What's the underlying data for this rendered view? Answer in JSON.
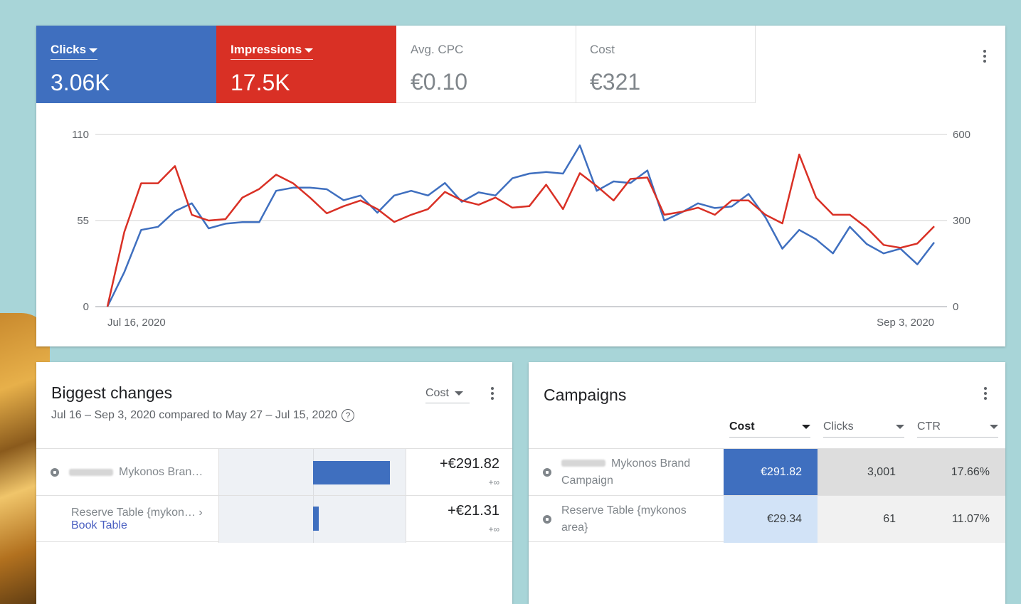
{
  "overview": {
    "metrics": [
      {
        "label": "Clicks",
        "value": "3.06K"
      },
      {
        "label": "Impressions",
        "value": "17.5K"
      },
      {
        "label": "Avg. CPC",
        "value": "€0.10"
      },
      {
        "label": "Cost",
        "value": "€321"
      }
    ],
    "colors": {
      "clicks": "#3f6fbf",
      "impressions": "#d93025"
    }
  },
  "chart_data": {
    "type": "line",
    "x_start_label": "Jul 16, 2020",
    "x_end_label": "Sep 3, 2020",
    "left_axis": {
      "ticks": [
        "110",
        "55",
        "0"
      ],
      "ylim": [
        0,
        110
      ]
    },
    "right_axis": {
      "ticks": [
        "600",
        "300",
        "0"
      ],
      "ylim": [
        0,
        600
      ]
    },
    "grid": true,
    "series": [
      {
        "name": "Clicks",
        "axis": "left",
        "color": "#3f6fbf",
        "values": [
          0,
          22,
          49,
          51,
          61,
          66,
          50,
          53,
          54,
          54,
          74,
          76,
          76,
          75,
          68,
          71,
          60,
          71,
          74,
          71,
          79,
          67,
          73,
          71,
          82,
          85,
          86,
          85,
          103,
          74,
          80,
          79,
          87,
          55,
          60,
          66,
          63,
          64,
          72,
          57,
          37,
          49,
          43,
          34,
          51,
          40,
          34,
          37,
          27,
          41
        ]
      },
      {
        "name": "Impressions",
        "axis": "right",
        "color": "#d93025",
        "values": [
          0,
          260,
          430,
          430,
          490,
          320,
          300,
          305,
          380,
          410,
          460,
          430,
          380,
          325,
          350,
          370,
          340,
          295,
          320,
          340,
          400,
          370,
          355,
          380,
          345,
          350,
          425,
          340,
          465,
          420,
          370,
          445,
          450,
          320,
          330,
          345,
          320,
          370,
          370,
          320,
          290,
          530,
          380,
          320,
          320,
          275,
          215,
          205,
          220,
          280
        ]
      }
    ]
  },
  "changes": {
    "title": "Biggest changes",
    "subtitle": "Jul 16 – Sep 3, 2020 compared to May 27 – Jul 15, 2020",
    "sort_label": "Cost",
    "rows": [
      {
        "name": "Mykonos Bran…",
        "value": "+€291.82",
        "sub": "+∞",
        "bar_fraction": 1.0
      },
      {
        "name": "Reserve Table {mykon… ›",
        "link": "Book Table",
        "value": "+€21.31",
        "sub": "+∞",
        "bar_fraction": 0.073
      }
    ]
  },
  "campaigns": {
    "title": "Campaigns",
    "columns": [
      "Cost",
      "Clicks",
      "CTR"
    ],
    "rows": [
      {
        "name_line1": "Mykonos Brand",
        "name_line2": "Campaign",
        "cost": "€291.82",
        "clicks": "3,001",
        "ctr": "17.66%"
      },
      {
        "name_line1": "Reserve Table {mykonos",
        "name_line2": "area}",
        "cost": "€29.34",
        "clicks": "61",
        "ctr": "11.07%"
      }
    ]
  }
}
